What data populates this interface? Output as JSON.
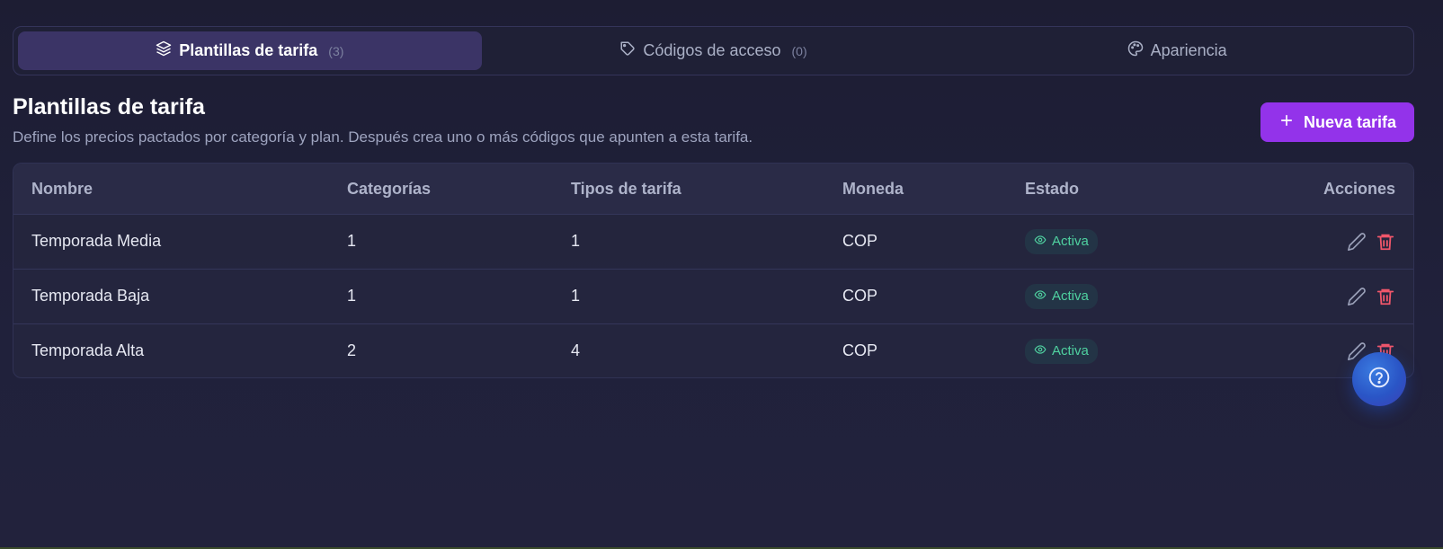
{
  "tabs": [
    {
      "label": "Plantillas de tarifa",
      "count": "(3)",
      "icon": "layers-icon"
    },
    {
      "label": "Códigos de acceso",
      "count": "(0)",
      "icon": "tag-icon"
    },
    {
      "label": "Apariencia",
      "count": "",
      "icon": "palette-icon"
    }
  ],
  "header": {
    "title": "Plantillas de tarifa",
    "subtitle": "Define los precios pactados por categoría y plan. Después crea uno o más códigos que apunten a esta tarifa.",
    "new_button": "Nueva tarifa"
  },
  "table": {
    "columns": [
      "Nombre",
      "Categorías",
      "Tipos de tarifa",
      "Moneda",
      "Estado",
      "Acciones"
    ],
    "rows": [
      {
        "name": "Temporada Media",
        "categories": "1",
        "types": "1",
        "currency": "COP",
        "status": "Activa"
      },
      {
        "name": "Temporada Baja",
        "categories": "1",
        "types": "1",
        "currency": "COP",
        "status": "Activa"
      },
      {
        "name": "Temporada Alta",
        "categories": "2",
        "types": "4",
        "currency": "COP",
        "status": "Activa"
      }
    ]
  },
  "colors": {
    "accent": "#9333ea",
    "active_tab": "#3b3466",
    "status_green": "#4fd1a0",
    "delete_red": "#f0566a"
  }
}
